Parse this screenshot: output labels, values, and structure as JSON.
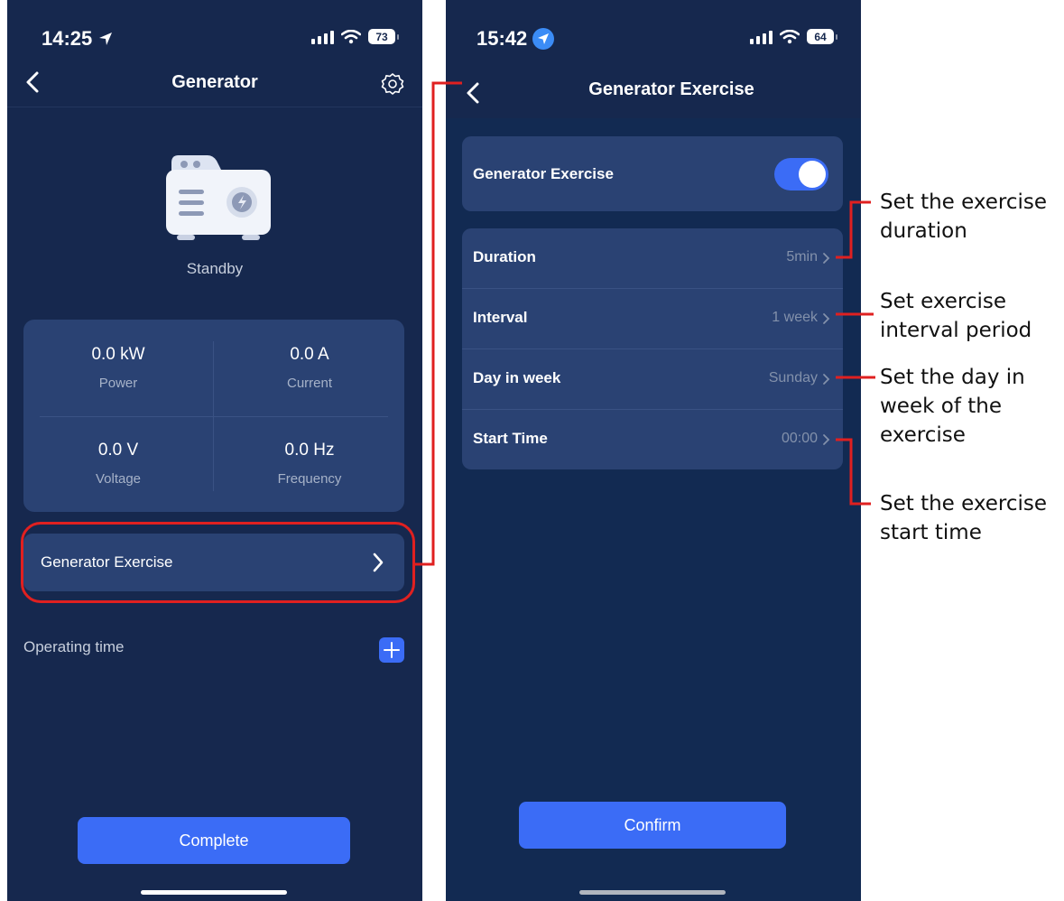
{
  "left_screen": {
    "status_time": "14:25",
    "battery": "73",
    "title": "Generator",
    "status": "Standby",
    "stats": [
      {
        "value": "0.0 kW",
        "label": "Power"
      },
      {
        "value": "0.0 A",
        "label": "Current"
      },
      {
        "value": "0.0 V",
        "label": "Voltage"
      },
      {
        "value": "0.0 Hz",
        "label": "Frequency"
      }
    ],
    "exercise_label": "Generator Exercise",
    "operating_time_label": "Operating time",
    "complete_label": "Complete"
  },
  "right_screen": {
    "status_time": "15:42",
    "battery": "64",
    "title": "Generator Exercise",
    "toggle_label": "Generator Exercise",
    "toggle_on": true,
    "rows": [
      {
        "label": "Duration",
        "value": "5min"
      },
      {
        "label": "Interval",
        "value": "1 week"
      },
      {
        "label": "Day in week",
        "value": "Sunday"
      },
      {
        "label": "Start Time",
        "value": "00:00"
      }
    ],
    "confirm_label": "Confirm"
  },
  "annotations": [
    "Set the exercise duration",
    "Set exercise interval period",
    "Set the day in week of the exercise",
    "Set the exercise start time"
  ],
  "colors": {
    "background": "#16284e",
    "card": "#2a4273",
    "accent": "#3b6cf6",
    "highlight": "#e02020"
  }
}
